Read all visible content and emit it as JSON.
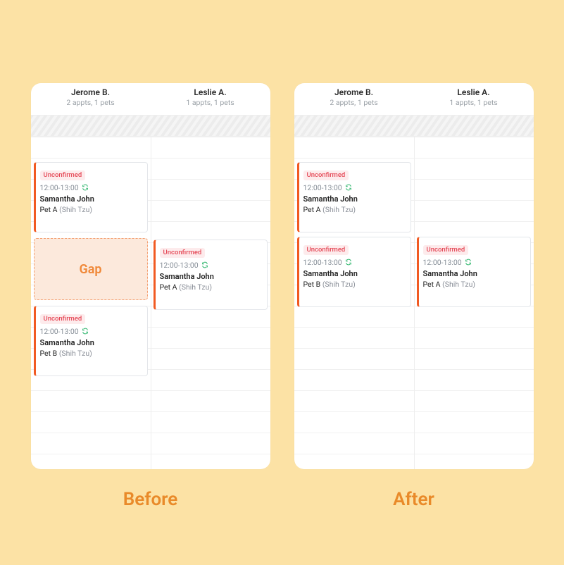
{
  "labels": {
    "before": "Before",
    "after": "After"
  },
  "staff": [
    {
      "name": "Jerome B.",
      "sub_before": "2 appts, 1 pets",
      "sub_after": "2 appts, 1 pets"
    },
    {
      "name": "Leslie A.",
      "sub_before": "1 appts, 1 pets",
      "sub_after": "1 appts, 1 pets"
    }
  ],
  "status": {
    "unconfirmed": "Unconfirmed"
  },
  "gap_label": "Gap",
  "appt_template": {
    "time": "12:00-13:00",
    "customer": "Samantha John",
    "petA": "Pet A",
    "petB": "Pet B",
    "breed": "(Shih Tzu)"
  }
}
